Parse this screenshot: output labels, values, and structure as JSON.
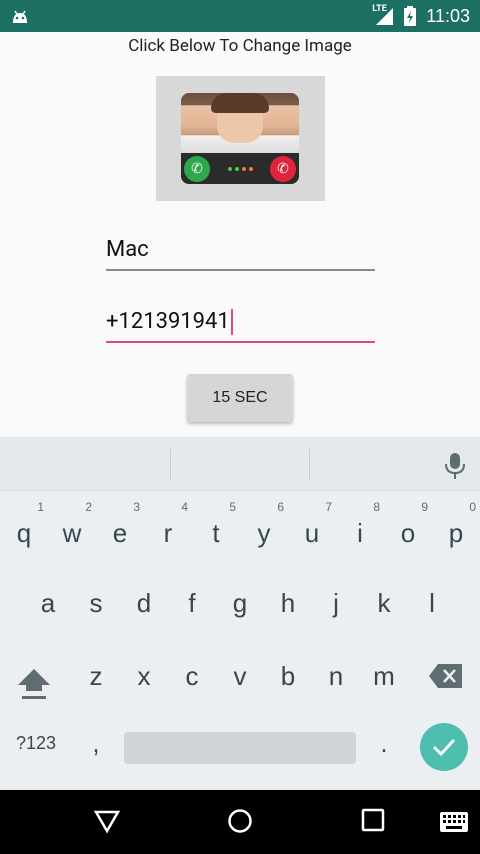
{
  "status_bar": {
    "time": "11:03",
    "network": "LTE"
  },
  "header": {
    "instruction": "Click Below To Change Image"
  },
  "form": {
    "name_value": "Mac",
    "phone_value": "+121391941",
    "delay_button_label": "15 SEC"
  },
  "keyboard": {
    "row1": [
      {
        "ch": "q",
        "hint": "1"
      },
      {
        "ch": "w",
        "hint": "2"
      },
      {
        "ch": "e",
        "hint": "3"
      },
      {
        "ch": "r",
        "hint": "4"
      },
      {
        "ch": "t",
        "hint": "5"
      },
      {
        "ch": "y",
        "hint": "6"
      },
      {
        "ch": "u",
        "hint": "7"
      },
      {
        "ch": "i",
        "hint": "8"
      },
      {
        "ch": "o",
        "hint": "9"
      },
      {
        "ch": "p",
        "hint": "0"
      }
    ],
    "row2": [
      "a",
      "s",
      "d",
      "f",
      "g",
      "h",
      "j",
      "k",
      "l"
    ],
    "row3": [
      "z",
      "x",
      "c",
      "v",
      "b",
      "n",
      "m"
    ],
    "symbols_label": "?123",
    "comma": ",",
    "period": "."
  },
  "colors": {
    "status_bar": "#1b6f63",
    "accent": "#e0487f",
    "enter_key": "#4ebfae"
  },
  "icons": [
    "android-icon",
    "lte-signal-icon",
    "battery-charging-icon",
    "mic-icon",
    "shift-icon",
    "backspace-icon",
    "check-icon",
    "back-icon",
    "home-icon",
    "recents-icon",
    "keyboard-switch-icon"
  ]
}
